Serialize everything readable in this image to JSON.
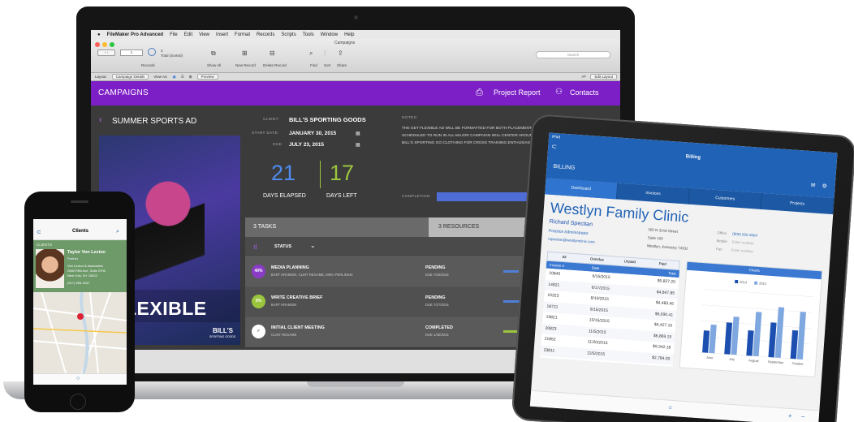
{
  "laptop": {
    "menubar": {
      "apple": "",
      "app": "FileMaker Pro Advanced",
      "items": [
        "File",
        "Edit",
        "View",
        "Insert",
        "Format",
        "Records",
        "Scripts",
        "Tools",
        "Window",
        "Help"
      ]
    },
    "window_title": "Campaigns",
    "toolbar": {
      "record_field": "1",
      "records_label": "Records",
      "total": "3",
      "total_note": "Total (Sorted)",
      "show_all": "Show All",
      "new_record": "New Record",
      "delete_record": "Delete Record",
      "find": "Find",
      "sort": "Sort",
      "share": "Share",
      "search_placeholder": "Search"
    },
    "layout_bar": {
      "layout_label": "Layout:",
      "layout_value": "Campaign Details",
      "view_as": "View As:",
      "preview": "Preview",
      "edit_layout": "Edit Layout",
      "font_a": "Aᴬ"
    },
    "header": {
      "title": "CAMPAIGNS",
      "project_report": "Project Report",
      "contacts": "Contacts"
    },
    "campaign": {
      "name": "SUMMER SPORTS AD",
      "client_label": "CLIENT:",
      "client": "BILL'S SPORTING GOODS",
      "start_label": "START DATE:",
      "start": "JANUARY 30, 2015",
      "due_label": "DUE:",
      "due": "JULY 23, 2015",
      "days_elapsed": "21",
      "days_elapsed_label": "DAYS ELAPSED",
      "days_left": "17",
      "days_left_label": "DAYS LEFT",
      "notes_label": "NOTES:",
      "notes": "THE GET FLEXIBLE AD WILL BE FORMATTED FOR BOTH PLACEMENT AND IS SCHEDULED TO RUN IN ALL MAJOR CAMPAIGN WILL CENTER AROUND BILL'S SPORTING GO CLOTHING FOR CROSS TRAINING ENTHUSIASTS.",
      "completion_label": "COMPLETION",
      "completion": 0.9,
      "promo_text": "T FLEXIBLE",
      "promo_brand": "BILL'S",
      "promo_brand_sub": "SPORTING GOODS"
    },
    "tabs": {
      "tasks": "3 TASKS",
      "resources": "3 RESOURCES"
    },
    "status_header": "STATUS",
    "tasks": [
      {
        "badge": "40%",
        "badge_color": "#8a3cc7",
        "title": "MEDIA PLANNING",
        "people": "BART KRAMSIN, CLINT REGAME, MIRA PERLINSKI",
        "status": "PENDING",
        "due": "DUE 7/20/2015",
        "bar_color": "#4f7fd8",
        "progress": 0.4
      },
      {
        "badge": "0%",
        "badge_color": "#9bc53d",
        "title": "WRITE CREATIVE BRIEF",
        "people": "BART KRAMSIN",
        "status": "PENDING",
        "due": "DUE 7/17/2015",
        "bar_color": "#4f7fd8",
        "progress": 0.6
      },
      {
        "badge": "✓",
        "badge_color": "#cccccc",
        "title": "INITIAL CLIENT MEETING",
        "people": "CLINT REGAME",
        "status": "COMPLETED",
        "due": "DUE 1/30/2015",
        "bar_color": "#9bc53d",
        "progress": 1.0
      }
    ]
  },
  "ipad": {
    "status_left": "iPad",
    "status_right": "",
    "title": "Billing",
    "section": "BILLING",
    "tabs": [
      "Dashboard",
      "Invoices",
      "Customers",
      "Projects"
    ],
    "client_name": "Westlyn Family Clinic",
    "contact_name": "Richard Specitan",
    "contact_role": "Practice Administrator",
    "contact_email": "rspecitan@westlynclinic.com",
    "address": [
      "300 N 32nd Street",
      "Suite 100",
      "Westlyn, Kentucky 74332"
    ],
    "phones": [
      {
        "label": "Office",
        "value": "(800) 555-3564"
      },
      {
        "label": "Mobile",
        "value": "Enter number"
      },
      {
        "label": "Fax",
        "value": "Enter number"
      }
    ],
    "filters": [
      "All",
      "Overdue",
      "Unpaid",
      "Paid"
    ],
    "grid_headers": [
      "Invoice #",
      "Date",
      "Total"
    ],
    "invoices": [
      {
        "num": "10845",
        "date": "6/15/2015",
        "total": "$5,827.20"
      },
      {
        "num": "14821",
        "date": "6/17/2015",
        "total": "$4,847.85"
      },
      {
        "num": "10323",
        "date": "8/10/2015",
        "total": "$4,483.45"
      },
      {
        "num": "18721",
        "date": "9/15/2015",
        "total": "$6,690.41"
      },
      {
        "num": "19821",
        "date": "10/15/2015",
        "total": "$4,427.10"
      },
      {
        "num": "20823",
        "date": "11/5/2015",
        "total": "$6,869.15"
      },
      {
        "num": "21852",
        "date": "11/20/2015",
        "total": "$9,342.18"
      },
      {
        "num": "23811",
        "date": "12/5/2015",
        "total": "$2,784.00"
      }
    ],
    "chart_title": "Charts",
    "legend": [
      "2014",
      "2015"
    ],
    "chart_data": {
      "type": "bar",
      "categories": [
        "June",
        "July",
        "August",
        "September",
        "October"
      ],
      "series": [
        {
          "name": "2014",
          "values": [
            35,
            50,
            40,
            55,
            45
          ]
        },
        {
          "name": "2015",
          "values": [
            45,
            60,
            70,
            80,
            75
          ]
        }
      ],
      "colors": [
        "#1c4fb0",
        "#7fa8e0"
      ],
      "ylim": [
        0,
        100
      ]
    }
  },
  "iphone": {
    "status": "",
    "title": "Clients",
    "section": "CLIENTS",
    "client": {
      "name": "Taylor Von Lexion",
      "role": "Partner",
      "company": "Von Lexion & Associates",
      "address": "2660 Fifth Ave, Suite 2700",
      "city": "New York, NY 10022",
      "phone": "(917) 555-1947"
    }
  }
}
